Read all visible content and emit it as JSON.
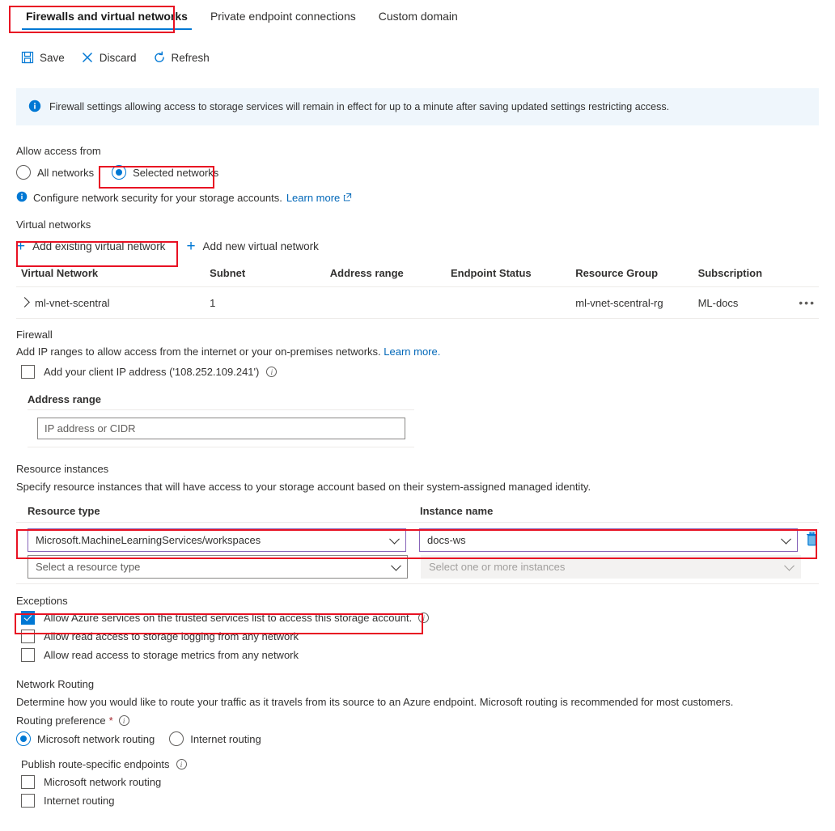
{
  "tabs": [
    {
      "label": "Firewalls and virtual networks",
      "active": true
    },
    {
      "label": "Private endpoint connections",
      "active": false
    },
    {
      "label": "Custom domain",
      "active": false
    }
  ],
  "toolbar": {
    "save_label": "Save",
    "discard_label": "Discard",
    "refresh_label": "Refresh"
  },
  "banner": {
    "text": "Firewall settings allowing access to storage services will remain in effect for up to a minute after saving updated settings restricting access."
  },
  "allow_access": {
    "title": "Allow access from",
    "options": [
      {
        "label": "All networks",
        "selected": false
      },
      {
        "label": "Selected networks",
        "selected": true
      }
    ],
    "hint_text": "Configure network security for your storage accounts.",
    "hint_link": "Learn more"
  },
  "virtual_networks": {
    "title": "Virtual networks",
    "add_existing_label": "Add existing virtual network",
    "add_new_label": "Add new virtual network",
    "columns": [
      "Virtual Network",
      "Subnet",
      "Address range",
      "Endpoint Status",
      "Resource Group",
      "Subscription"
    ],
    "rows": [
      {
        "virtual_network": "ml-vnet-scentral",
        "subnet": "1",
        "address_range": "",
        "endpoint_status": "",
        "resource_group": "ml-vnet-scentral-rg",
        "subscription": "ML-docs",
        "menu": "•••"
      }
    ]
  },
  "firewall": {
    "title": "Firewall",
    "description": "Add IP ranges to allow access from the internet or your on-premises networks.",
    "description_link": "Learn more.",
    "client_ip_label": "Add your client IP address ('108.252.109.241')",
    "client_ip_checked": false,
    "address_range_label": "Address range",
    "address_range_value": "",
    "address_range_placeholder": "IP address or CIDR"
  },
  "resource_instances": {
    "title": "Resource instances",
    "description": "Specify resource instances that will have access to your storage account based on their system-assigned managed identity.",
    "col_resource_type": "Resource type",
    "col_instance_name": "Instance name",
    "rows": [
      {
        "resource_type": "Microsoft.MachineLearningServices/workspaces",
        "instance_name": "docs-ws",
        "filled": true
      },
      {
        "resource_type": "Select a resource type",
        "instance_name": "Select one or more instances",
        "filled": false
      }
    ]
  },
  "exceptions": {
    "title": "Exceptions",
    "items": [
      {
        "label": "Allow Azure services on the trusted services list to access this storage account.",
        "checked": true,
        "info": true
      },
      {
        "label": "Allow read access to storage logging from any network",
        "checked": false,
        "info": false
      },
      {
        "label": "Allow read access to storage metrics from any network",
        "checked": false,
        "info": false
      }
    ]
  },
  "network_routing": {
    "title": "Network Routing",
    "description": "Determine how you would like to route your traffic as it travels from its source to an Azure endpoint. Microsoft routing is recommended for most customers.",
    "routing_preference_label": "Routing preference",
    "required_mark": "*",
    "options": [
      {
        "label": "Microsoft network routing",
        "selected": true
      },
      {
        "label": "Internet routing",
        "selected": false
      }
    ],
    "publish_label": "Publish route-specific endpoints",
    "publish_options": [
      {
        "label": "Microsoft network routing",
        "checked": false
      },
      {
        "label": "Internet routing",
        "checked": false
      }
    ]
  },
  "colors": {
    "accent": "#0078d4",
    "highlight": "#e81123",
    "banner_bg": "#eff6fc",
    "filled_border": "#8764b8",
    "link": "#0067b8"
  }
}
